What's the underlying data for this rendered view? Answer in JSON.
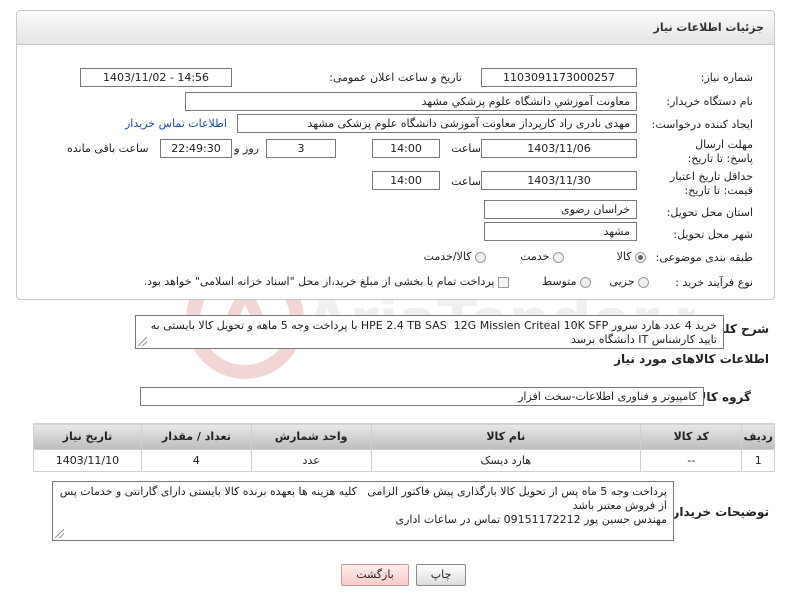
{
  "header": {
    "title": "جزئیات اطلاعات نیاز"
  },
  "fields": {
    "need_number_label": "شماره نیاز:",
    "need_number": "1103091173000257",
    "announce_label": "تاریخ و ساعت اعلان عمومی:",
    "announce_value": "1403/11/02 - 14:56",
    "buyer_org_label": "نام دستگاه خریدار:",
    "buyer_org": "معاونت آموزشي دانشگاه علوم پزشكي مشهد",
    "requester_label": "ایجاد کننده درخواست:",
    "requester": "مهدی نادری راد کارپرداز معاونت آموزشی دانشگاه علوم پزشکی مشهد",
    "contact_link": "اطلاعات تماس خریدار",
    "deadline_label": "مهلت ارسال پاسخ: تا تاریخ:",
    "deadline_date": "1403/11/06",
    "time_label": "ساعت",
    "deadline_time": "14:00",
    "days_value": "3",
    "days_label": "روز و",
    "remaining_time": "22:49:30",
    "remaining_label": "ساعت باقی مانده",
    "validity_label": "حداقل تاریخ اعتبار قیمت: تا تاریخ:",
    "validity_date": "1403/11/30",
    "validity_time": "14:00",
    "province_label": "استان محل تحویل:",
    "province": "خراسان رضوی",
    "city_label": "شهر محل تحویل:",
    "city": "مشهد",
    "category_label": "طبقه بندی موضوعی:",
    "category_options": [
      "کالا",
      "خدمت",
      "کالا/خدمت"
    ],
    "process_label": "نوع فرآیند خرید :",
    "process_options": [
      "جزیی",
      "متوسط"
    ],
    "payment_note": "پرداخت تمام یا بخشی از مبلغ خرید،از محل \"اسناد خزانه اسلامی\" خواهد بود."
  },
  "summary": {
    "label": "شرح کلی نیاز:",
    "text": "خرید 4 عدد هارد سرور HPE 2.4 TB SAS  12G Missien Criteal 10K SFP با پرداخت وجه 5 ماهه و تحویل کالا بایستی به تایید کارشناس IT دانشگاه برسد"
  },
  "goods_info": {
    "title": "اطلاعات کالاهای مورد نیاز",
    "group_label": "گروه کالا:",
    "group_value": "کامپیوتر و فناوری اطلاعات-سخت افزار"
  },
  "table": {
    "headers": [
      "ردیف",
      "کد کالا",
      "نام کالا",
      "واحد شمارش",
      "تعداد / مقدار",
      "تاریخ نیاز"
    ],
    "rows": [
      [
        "1",
        "--",
        "هارد دیسک",
        "عدد",
        "4",
        "1403/11/10"
      ]
    ]
  },
  "buyer_notes": {
    "label": "توضیحات خریدار:",
    "text": "پرداخت وجه 5 ماه پس از تحویل کالا بارگذاری پیش فاکتور الزامی   کلیه هزینه ها بعهده برنده کالا بایستی دارای گارانتی و خدمات پس از فروش معتبر باشد\nمهندس حسین پور 09151172212 تماس در ساعات اداری"
  },
  "buttons": {
    "print": "چاپ",
    "back": "بازگشت"
  },
  "watermark": {
    "text": "AriaTender.neT"
  }
}
